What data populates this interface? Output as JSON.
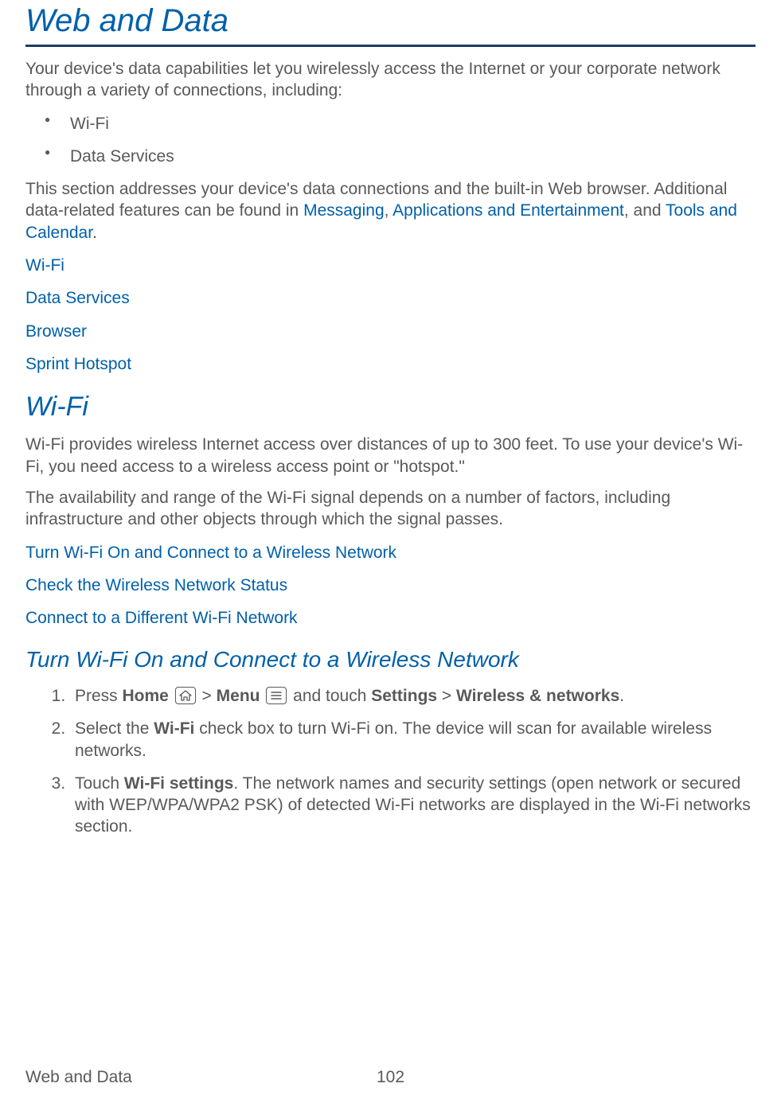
{
  "h1": "Web and Data",
  "intro": "Your device's data capabilities let you wirelessly access the Internet or your corporate network through a variety of connections, including:",
  "bullets": [
    "Wi-Fi",
    "Data Services"
  ],
  "para2_pre": "This section addresses your device's data connections and the built-in Web browser. Additional data-related features can be found in ",
  "para2_link1": "Messaging",
  "para2_mid1": ", ",
  "para2_link2": "Applications and Entertainment",
  "para2_mid2": ", and ",
  "para2_link3": "Tools and Calendar",
  "para2_end": ".",
  "toc": [
    "Wi-Fi",
    "Data Services",
    "Browser",
    "Sprint Hotspot"
  ],
  "h2_wifi": "Wi-Fi",
  "wifi_p1": "Wi-Fi provides wireless Internet access over distances of up to 300 feet. To use your device's Wi-Fi, you need access to a wireless access point or \"hotspot.\"",
  "wifi_p2": "The availability and range of the Wi-Fi signal depends on a number of factors, including infrastructure and other objects through which the signal passes.",
  "wifi_links": [
    "Turn Wi-Fi On and Connect to a Wireless Network",
    "Check the Wireless Network Status",
    "Connect to a Different Wi-Fi Network"
  ],
  "h3_turn": "Turn Wi-Fi On and Connect to a Wireless Network",
  "steps": {
    "s1": {
      "a": "Press ",
      "home": "Home",
      "b": " > ",
      "menu": "Menu",
      "c": " and touch ",
      "settings": "Settings",
      "d": " > ",
      "wn": "Wireless & networks",
      "e": "."
    },
    "s2": {
      "a": "Select the ",
      "wifi": "Wi-Fi",
      "b": " check box to turn Wi-Fi on. The device will scan for available wireless networks."
    },
    "s3": {
      "a": "Touch ",
      "wfs": "Wi-Fi settings",
      "b": ". The network names and security settings (open network or secured with WEP/WPA/WPA2 PSK) of detected Wi-Fi networks are displayed in the Wi-Fi networks section."
    }
  },
  "footer": {
    "left": "Web and Data",
    "page": "102"
  }
}
